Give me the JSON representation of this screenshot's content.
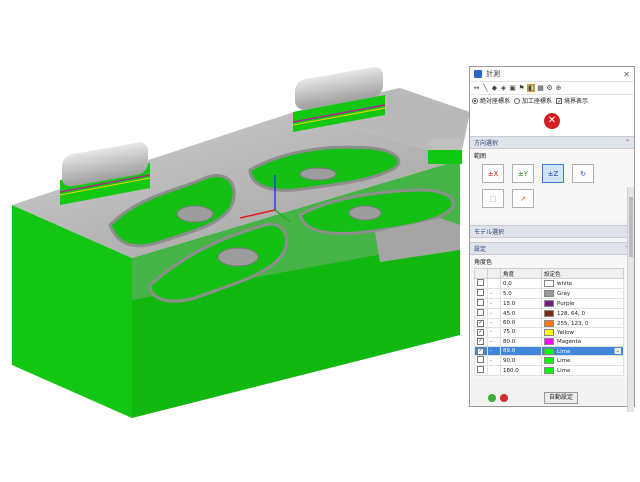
{
  "panel": {
    "title": "計測",
    "toolbar_icons": [
      "axis-line-icon",
      "line-icon",
      "plane-icon",
      "solid-icon",
      "box-icon",
      "flag-icon",
      "measure-icon",
      "table-icon",
      "settings-icon",
      "zoom-icon"
    ],
    "radio_options": [
      {
        "label": "絶対座標系",
        "selected": true
      },
      {
        "label": "加工座標系",
        "selected": false
      }
    ],
    "checkbox_label": "境界表示",
    "sections": {
      "direction": {
        "title": "方向選択",
        "subtitle": "範囲"
      },
      "model": {
        "title": "モデル選択"
      },
      "settings": {
        "title": "設定",
        "subtitle": "角度色"
      }
    },
    "direction_buttons": [
      {
        "icon": "±X",
        "selected": false
      },
      {
        "icon": "±Y",
        "selected": false
      },
      {
        "icon": "±Z",
        "selected": true
      },
      {
        "icon": "rotate-icon",
        "selected": false
      },
      {
        "icon": "zoom-fit-icon",
        "selected": false
      },
      {
        "icon": "arrow-icon",
        "selected": false
      }
    ],
    "table": {
      "headers": [
        "",
        "",
        "角度",
        "設定色"
      ],
      "rows": [
        {
          "check": "",
          "dash": "",
          "angle": "0.0",
          "color": "#ffffff",
          "color_label": "white"
        },
        {
          "check": "",
          "dash": "-",
          "angle": "5.0",
          "color": "#9a9a9a",
          "color_label": "Gray"
        },
        {
          "check": "",
          "dash": "-",
          "angle": "15.0",
          "color": "#7a1b8a",
          "color_label": "Purple"
        },
        {
          "check": "",
          "dash": "-",
          "angle": "45.0",
          "color": "#7a2b12",
          "color_label": "128, 64, 0"
        },
        {
          "check": "✓",
          "dash": "-",
          "angle": "60.0",
          "color": "#ff7b00",
          "color_label": "255, 123, 0"
        },
        {
          "check": "✓",
          "dash": "-",
          "angle": "75.0",
          "color": "#ffff00",
          "color_label": "Yellow"
        },
        {
          "check": "✓",
          "dash": "-",
          "angle": "80.0",
          "color": "#ff00ff",
          "color_label": "Magenta"
        },
        {
          "check": "✓",
          "dash": "-",
          "angle": "89.0",
          "color": "#00ff00",
          "color_label": "Lime",
          "selected": true
        },
        {
          "check": "",
          "dash": "-",
          "angle": "90.0",
          "color": "#00ff00",
          "color_label": "Lime"
        },
        {
          "check": "",
          "dash": "",
          "angle": "180.0",
          "color": "#00ff00",
          "color_label": "Lime"
        }
      ]
    },
    "auto_button": "自動設定",
    "colors": {
      "model_gray": "#b8b8b8",
      "model_green": "#12c812",
      "accent_blue": "#3f88d9"
    }
  }
}
